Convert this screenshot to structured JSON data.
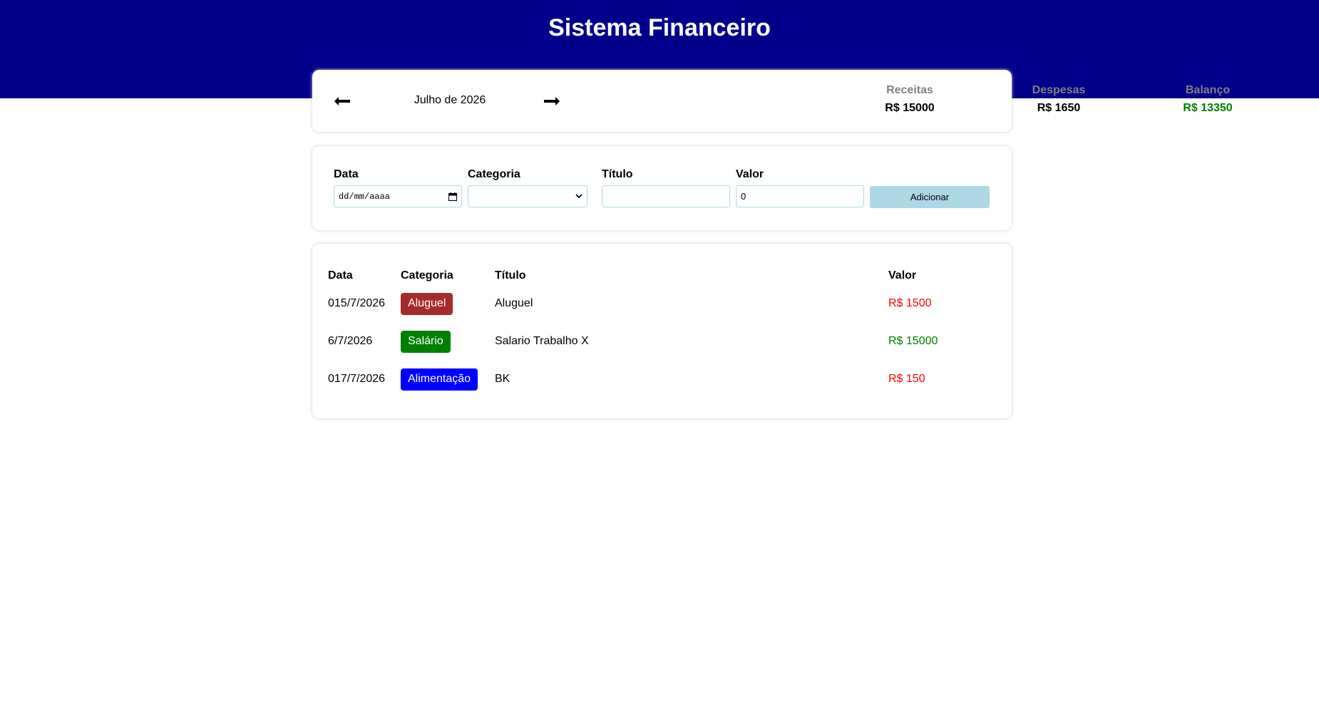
{
  "header": {
    "title": "Sistema Financeiro"
  },
  "info": {
    "month": "Julho de 2026",
    "income": {
      "label": "Receitas",
      "value": "R$ 15000",
      "color": "#000000"
    },
    "expense": {
      "label": "Despesas",
      "value": "R$ 1650",
      "color": "#000000"
    },
    "balance": {
      "label": "Balanço",
      "value": "R$ 13350",
      "color": "#008000"
    }
  },
  "form": {
    "date": {
      "label": "Data",
      "placeholder": "dd/mm/aaaa"
    },
    "category": {
      "label": "Categoria",
      "selected": ""
    },
    "title": {
      "label": "Título",
      "value": ""
    },
    "value": {
      "label": "Valor",
      "value": "0"
    },
    "add_label": "Adicionar"
  },
  "table": {
    "headers": {
      "date": "Data",
      "category": "Categoria",
      "title": "Título",
      "value": "Valor"
    },
    "rows": [
      {
        "date": "015/7/2026",
        "category": "Aluguel",
        "category_color": "#a52a2a",
        "title": "Aluguel",
        "value": "R$ 1500",
        "value_color": "#ff0000"
      },
      {
        "date": "6/7/2026",
        "category": "Salário",
        "category_color": "#008000",
        "title": "Salario Trabalho X",
        "value": "R$ 15000",
        "value_color": "#008000"
      },
      {
        "date": "017/7/2026",
        "category": "Alimentação",
        "category_color": "#0000ff",
        "title": "BK",
        "value": "R$ 150",
        "value_color": "#ff0000"
      }
    ]
  },
  "icons": {
    "prev": "arrow-left-icon",
    "next": "arrow-right-icon",
    "calendar": "calendar-icon",
    "dropdown": "chevron-down-icon"
  }
}
